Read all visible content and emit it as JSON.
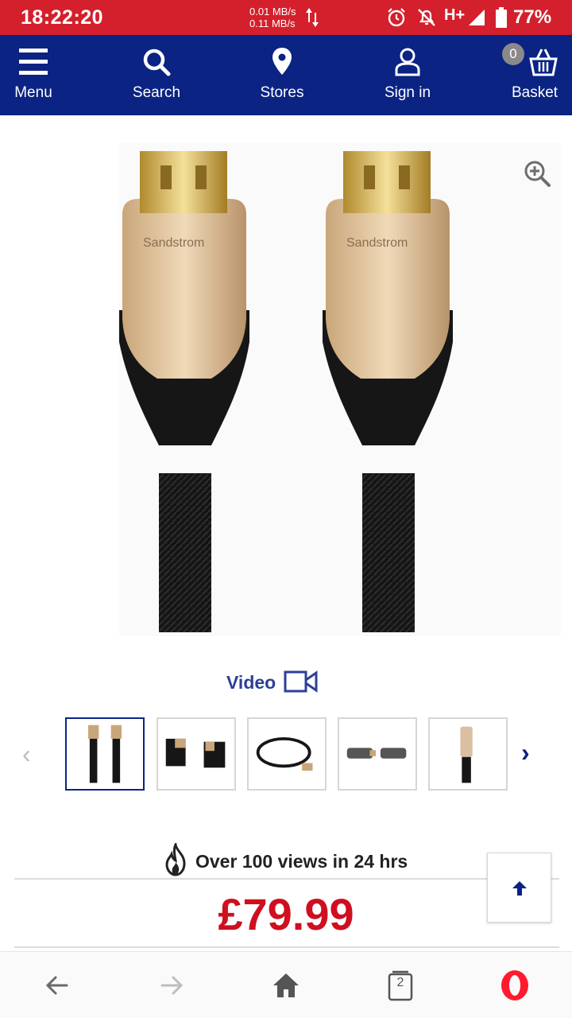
{
  "status_bar": {
    "time": "18:22:20",
    "upload_speed": "0.01 MB/s",
    "download_speed": "0.11 MB/s",
    "network_type": "H+",
    "battery": "77%",
    "bg_color": "#d3202c"
  },
  "nav": {
    "bg_color": "#0b2383",
    "menu_label": "Menu",
    "search_label": "Search",
    "stores_label": "Stores",
    "signin_label": "Sign in",
    "basket_label": "Basket",
    "basket_count": "0"
  },
  "product": {
    "image_icon": "hdmi-cable-image",
    "brand_on_image": "Sandstrom",
    "video_label": "Video",
    "thumbnail_count": 5,
    "selected_thumbnail": 1,
    "views_text": "Over 100 views in 24 hrs",
    "price": "£79.99",
    "price_color": "#cf0f1f"
  },
  "browser": {
    "tab_count": "2"
  }
}
